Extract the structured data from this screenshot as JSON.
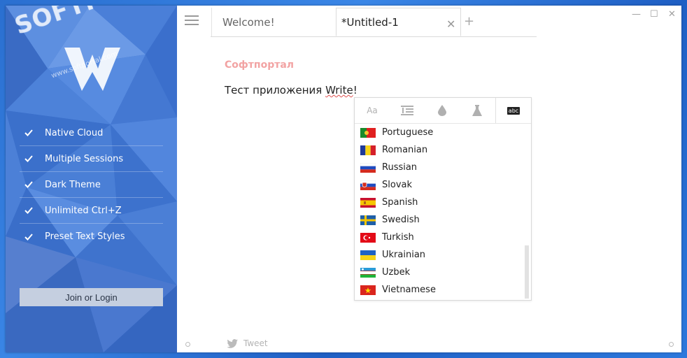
{
  "window": {
    "controls": {
      "minimize": "—",
      "maximize": "☐",
      "close": "✕"
    }
  },
  "sidebar": {
    "watermark": "SOFTPORTAL",
    "watermark_sub": "www.softportal.com",
    "watermark_tm": "™",
    "features": [
      {
        "label": "Native Cloud"
      },
      {
        "label": "Multiple Sessions"
      },
      {
        "label": "Dark Theme"
      },
      {
        "label": "Unlimited Ctrl+Z"
      },
      {
        "label": "Preset Text Styles"
      }
    ],
    "join_label": "Join or Login"
  },
  "tabs": [
    {
      "label": "Welcome!",
      "active": false
    },
    {
      "label": "*Untitled-1",
      "active": true
    }
  ],
  "tab_close": "✕",
  "tab_add": "+",
  "editor": {
    "title": "Софтпортал",
    "body_prefix": "Тест приложения ",
    "body_misspelled": "Write",
    "body_suffix": "!"
  },
  "panel": {
    "tabs": [
      {
        "icon": "font-size-icon",
        "label": "Aa"
      },
      {
        "icon": "line-spacing-icon"
      },
      {
        "icon": "color-drop-icon"
      },
      {
        "icon": "style-flask-icon"
      },
      {
        "icon": "spellcheck-icon",
        "label": "abc",
        "active": true
      }
    ],
    "languages": [
      {
        "name": "Portuguese",
        "flag": "pt"
      },
      {
        "name": "Romanian",
        "flag": "ro"
      },
      {
        "name": "Russian",
        "flag": "ru"
      },
      {
        "name": "Slovak",
        "flag": "sk"
      },
      {
        "name": "Spanish",
        "flag": "es"
      },
      {
        "name": "Swedish",
        "flag": "se"
      },
      {
        "name": "Turkish",
        "flag": "tr"
      },
      {
        "name": "Ukrainian",
        "flag": "ua"
      },
      {
        "name": "Uzbek",
        "flag": "uz"
      },
      {
        "name": "Vietnamese",
        "flag": "vn"
      }
    ]
  },
  "footer": {
    "tweet_label": "Tweet"
  },
  "colors": {
    "accent": "#3f74cf",
    "title_pink": "#f2a3a3",
    "spell_underline": "#e05050"
  }
}
